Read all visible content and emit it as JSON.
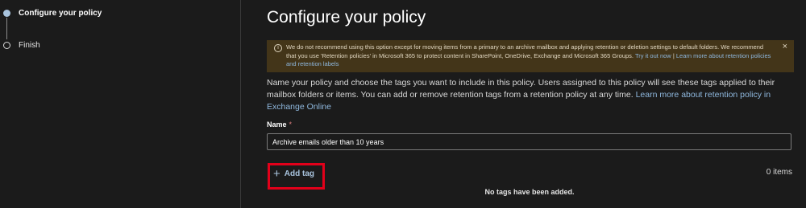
{
  "wizard": {
    "steps": [
      {
        "label": "Configure your policy",
        "state": "current"
      },
      {
        "label": "Finish",
        "state": "pending"
      }
    ]
  },
  "main": {
    "title": "Configure your policy",
    "warning": {
      "icon": "info-icon",
      "text": "We do not recommend using this option except for moving items from a primary to an archive mailbox and applying retention or deletion settings to default folders. We recommend that you use 'Retention policies' in Microsoft 365 to protect content in SharePoint, OneDrive, Exchange and Microsoft 365 Groups.",
      "link_try": "Try it out now",
      "separator": "|",
      "link_learn": "Learn more about retention policies and retention labels",
      "close": "×"
    },
    "description": {
      "text": "Name your policy and choose the tags you want to include in this policy. Users assigned to this policy will see these tags applied to their mailbox folders or items. You can add or remove retention tags from a retention policy at any time.",
      "link": "Learn more about retention policy in Exchange Online"
    },
    "name_field": {
      "label": "Name",
      "required_mark": "*",
      "value": "Archive emails older than 10 years"
    },
    "tags": {
      "add_label": "Add tag",
      "plus": "+",
      "count_text": "0 items",
      "empty_text": "No tags have been added."
    }
  },
  "colors": {
    "background": "#1b1b1b",
    "warning_bg": "#433519",
    "link": "#8fb8de",
    "highlight": "#e2001a"
  }
}
